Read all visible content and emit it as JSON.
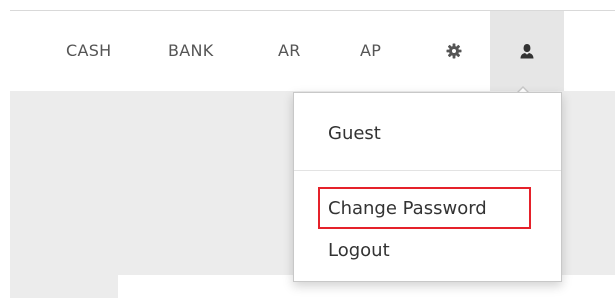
{
  "navbar": {
    "items": [
      {
        "label": "CASH"
      },
      {
        "label": "BANK"
      },
      {
        "label": "AR"
      },
      {
        "label": "AP"
      }
    ],
    "settings_icon": "gear-icon",
    "user_icon": "user-icon"
  },
  "user_menu": {
    "username": "Guest",
    "change_password_label": "Change Password",
    "logout_label": "Logout"
  },
  "colors": {
    "highlight": "#e5212a",
    "active_nav_background": "#e6e6e6",
    "content_background": "#ececec"
  }
}
